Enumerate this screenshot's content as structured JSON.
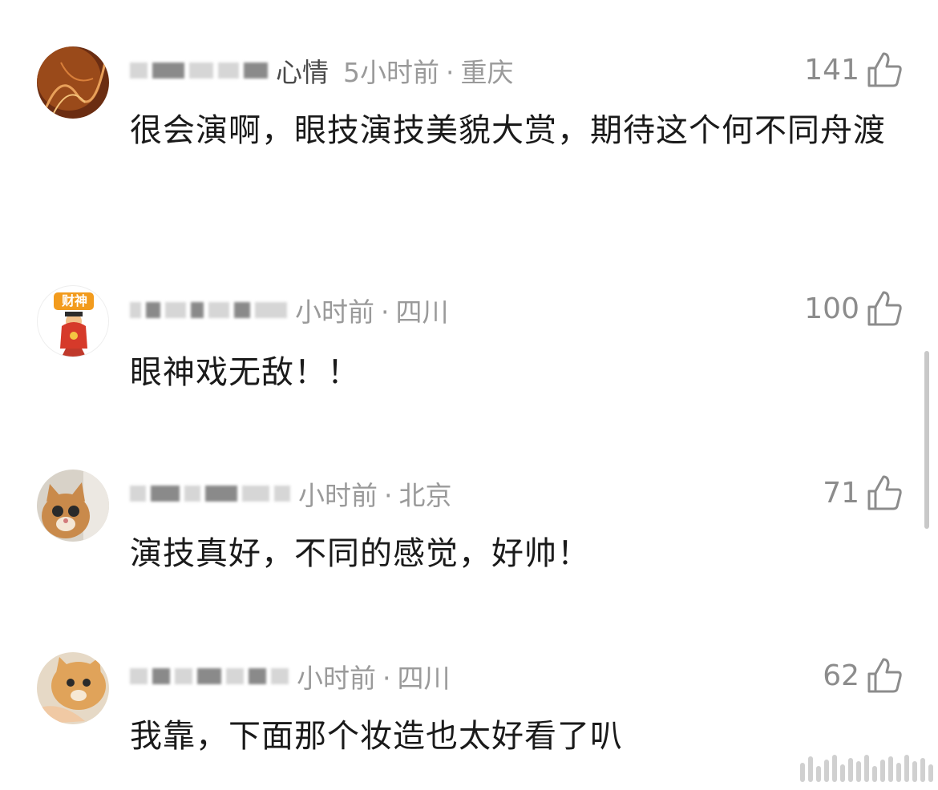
{
  "comments": [
    {
      "name_visible": "心情",
      "meta": {
        "time": "5小时前",
        "location": "重庆"
      },
      "likes": "141",
      "text": "很会演啊，眼技演技美貌大赏，期待这个何不同舟渡",
      "avatar": "sunset-tree-avatar"
    },
    {
      "name_visible": "",
      "meta": {
        "time": "小时前",
        "location": "四川"
      },
      "likes": "100",
      "text": "眼神戏无敌！！",
      "avatar": "caishen-avatar",
      "avatar_badge": "财神"
    },
    {
      "name_visible": "",
      "meta": {
        "time": "小时前",
        "location": "北京"
      },
      "likes": "71",
      "text": "演技真好，不同的感觉，好帅！",
      "avatar": "cat-peeking-avatar"
    },
    {
      "name_visible": "",
      "meta": {
        "time": "小时前",
        "location": "四川"
      },
      "likes": "62",
      "text": "我靠，下面那个妆造也太好看了叭",
      "avatar": "orange-cat-avatar"
    }
  ],
  "icons": {
    "like": "thumbs-up-icon"
  },
  "colors": {
    "meta_gray": "#9a9a9a",
    "text": "#1a1a1a",
    "badge_orange": "#f29b1d"
  }
}
